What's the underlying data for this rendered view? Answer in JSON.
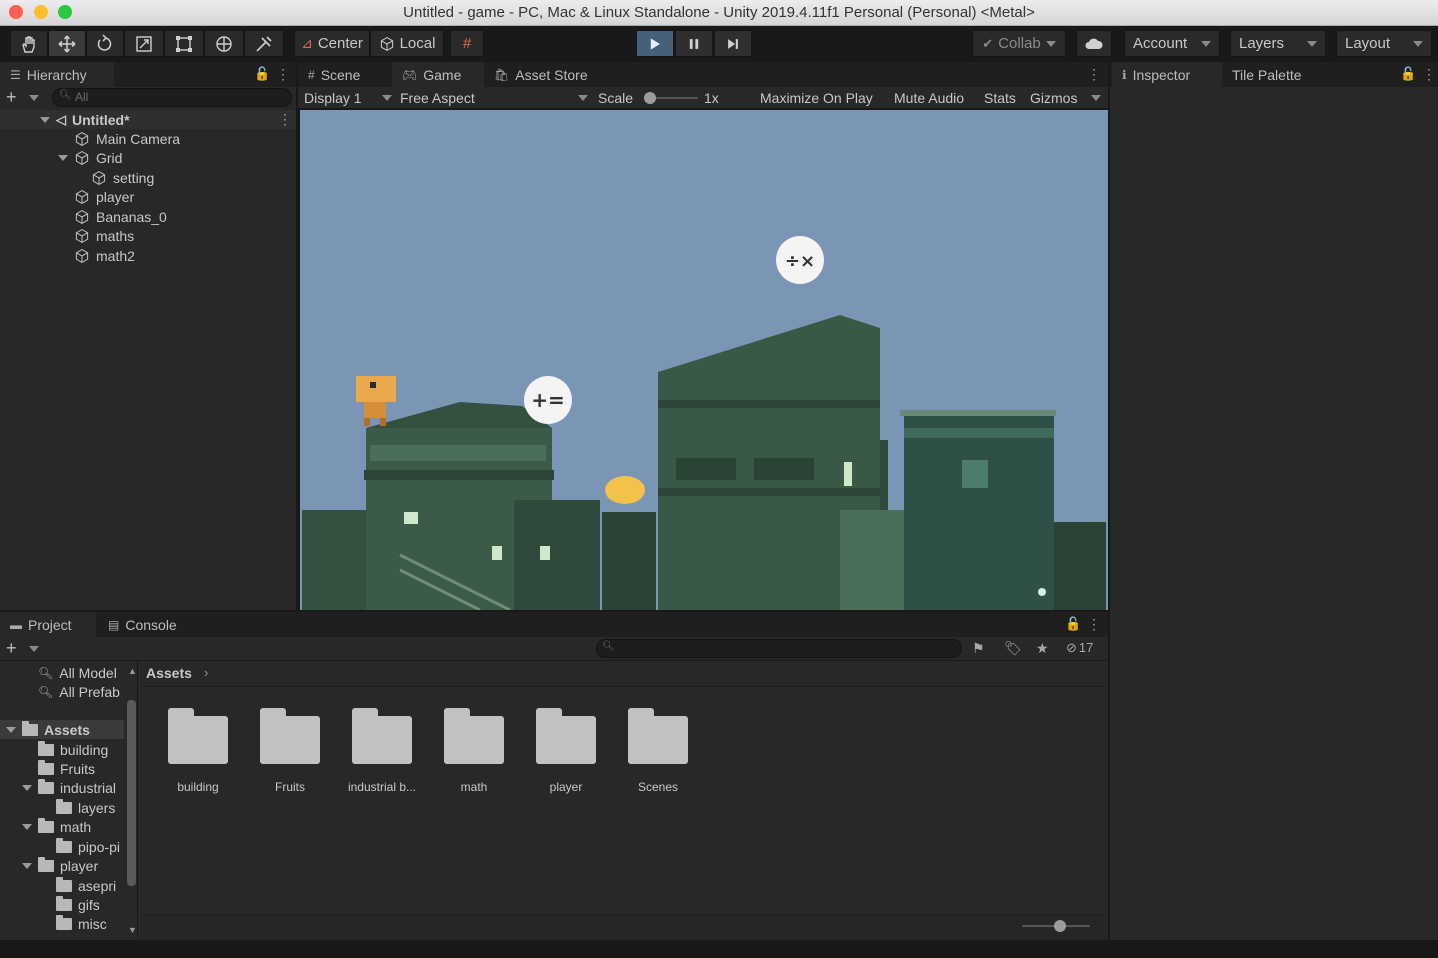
{
  "window": {
    "title": "Untitled - game - PC, Mac & Linux Standalone - Unity 2019.4.11f1 Personal (Personal) <Metal>"
  },
  "toolbar": {
    "pivot_label": "Center",
    "space_label": "Local",
    "collab_label": "Collab",
    "account_label": "Account",
    "layers_label": "Layers",
    "layout_label": "Layout"
  },
  "hierarchy": {
    "tab_label": "Hierarchy",
    "search_placeholder": "All",
    "scene_name": "Untitled*",
    "items": [
      {
        "label": "Main Camera"
      },
      {
        "label": "Grid"
      },
      {
        "label": "setting"
      },
      {
        "label": "player"
      },
      {
        "label": "Bananas_0"
      },
      {
        "label": "maths"
      },
      {
        "label": "math2"
      }
    ]
  },
  "center_tabs": {
    "scene": "Scene",
    "game": "Game",
    "asset_store": "Asset Store"
  },
  "game_bar": {
    "display": "Display 1",
    "aspect": "Free Aspect",
    "scale_label": "Scale",
    "scale_value": "1x",
    "maximize": "Maximize On Play",
    "mute": "Mute Audio",
    "stats": "Stats",
    "gizmos": "Gizmos"
  },
  "game_view": {
    "bubble_top": "÷×",
    "bubble_left": "+=",
    "colors": {
      "sky": "#7b96b5",
      "building_dark": "#2f4a3b",
      "building_mid": "#3f5e4b",
      "building_light": "#567a62",
      "player": "#e9a84c",
      "banana": "#f2c24a"
    }
  },
  "right_tabs": {
    "inspector": "Inspector",
    "tile_palette": "Tile Palette"
  },
  "bottom_tabs": {
    "project": "Project",
    "console": "Console"
  },
  "project": {
    "favorites": [
      "All Model",
      "All Prefab"
    ],
    "breadcrumb": "Assets",
    "hidden_count": "17",
    "tree": [
      {
        "label": "Assets"
      },
      {
        "label": "building"
      },
      {
        "label": "Fruits"
      },
      {
        "label": "industrial"
      },
      {
        "label": "layers"
      },
      {
        "label": "math"
      },
      {
        "label": "pipo-pi"
      },
      {
        "label": "player"
      },
      {
        "label": "asepri"
      },
      {
        "label": "gifs"
      },
      {
        "label": "misc"
      }
    ],
    "folders": [
      {
        "label": "building"
      },
      {
        "label": "Fruits"
      },
      {
        "label": "industrial b..."
      },
      {
        "label": "math"
      },
      {
        "label": "player"
      },
      {
        "label": "Scenes"
      }
    ]
  }
}
